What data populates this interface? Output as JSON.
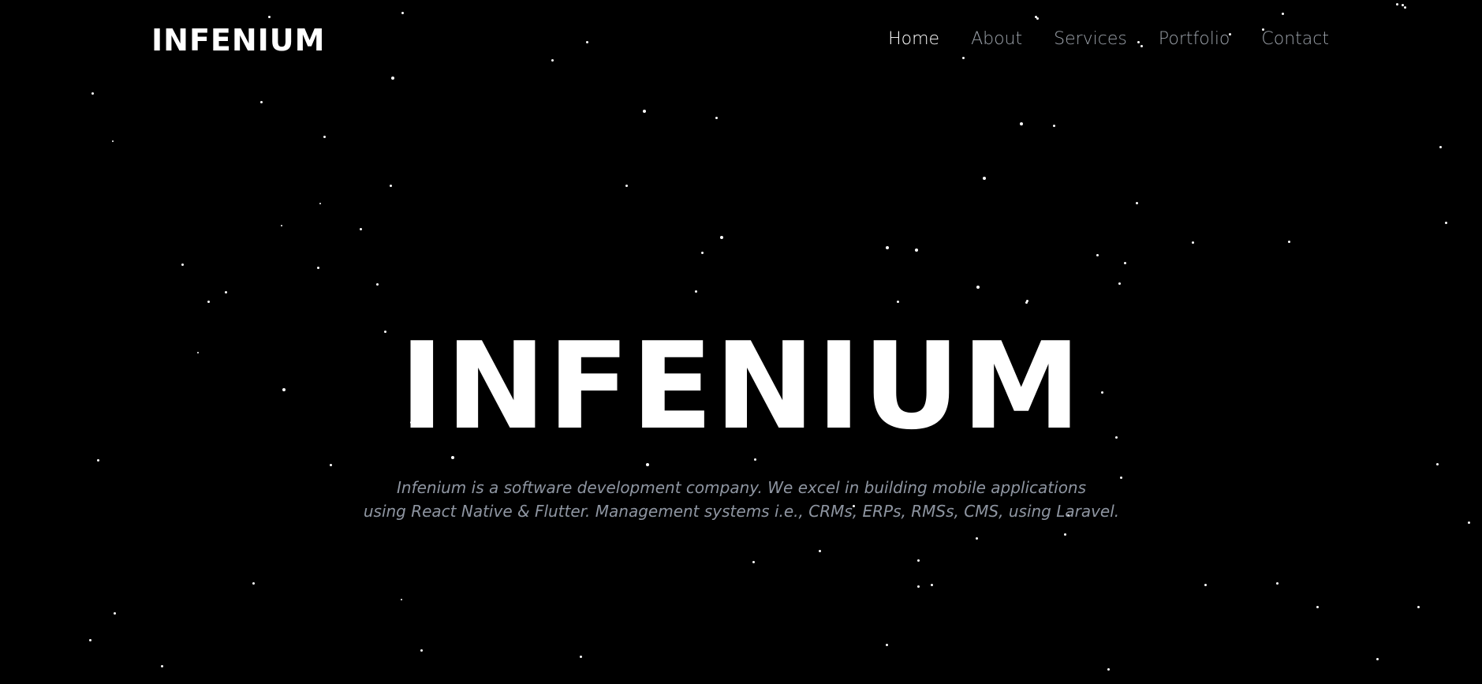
{
  "header": {
    "brand": "INFENIUM",
    "nav": [
      {
        "label": "Home",
        "active": true
      },
      {
        "label": "About",
        "active": false
      },
      {
        "label": "Services",
        "active": false
      },
      {
        "label": "Portfolio",
        "active": false
      },
      {
        "label": "Contact",
        "active": false
      }
    ]
  },
  "hero": {
    "title": "INFENIUM",
    "description_line1": "Infenium is a software development company. We excel in building mobile applications",
    "description_line2": "using React Native & Flutter. Management systems i.e., CRMs, ERPs, RMSs, CMS, using Laravel."
  },
  "colors": {
    "background": "#000000",
    "text_primary": "#ffffff",
    "nav_inactive": "#9aa0a8",
    "description": "#8e95a1",
    "star": "#ffffff"
  }
}
